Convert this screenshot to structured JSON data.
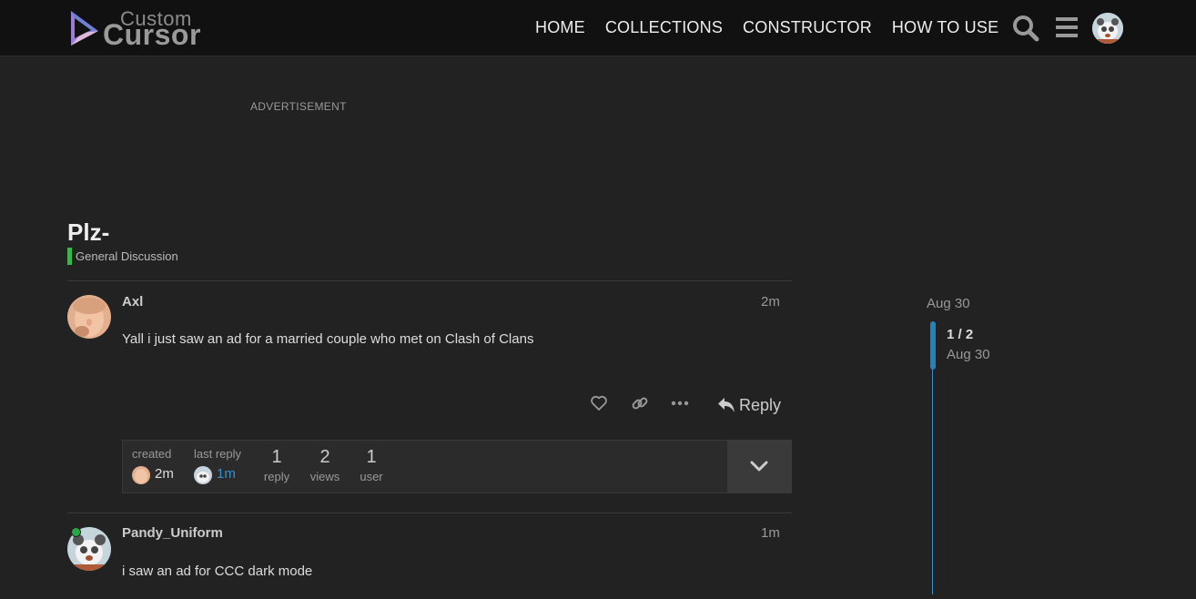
{
  "header": {
    "logo": {
      "line1": "Custom",
      "line2": "Cursor"
    },
    "nav": [
      "HOME",
      "COLLECTIONS",
      "CONSTRUCTOR",
      "HOW TO USE"
    ],
    "icons": [
      "search-icon",
      "hamburger-menu-icon",
      "user-avatar"
    ]
  },
  "ad": {
    "label": "ADVERTISEMENT"
  },
  "topic": {
    "title": "Plz-",
    "category": {
      "name": "General Discussion",
      "color": "#3ab54a"
    }
  },
  "posts": [
    {
      "username": "Axl",
      "age": "2m",
      "body": "Yall i just saw an ad for a married couple who met on Clash of Clans",
      "actions": [
        "heart-icon",
        "link-icon",
        "more-icon"
      ],
      "reply_label": "Reply"
    },
    {
      "username": "Pandy_Uniform",
      "age": "1m",
      "body": "i saw an ad for CCC dark mode",
      "online": true
    }
  ],
  "topic_map": {
    "created_label": "created",
    "created_time": "2m",
    "last_reply_label": "last reply",
    "last_reply_time": "1m",
    "stats": [
      {
        "value": "1",
        "label": "reply"
      },
      {
        "value": "2",
        "label": "views"
      },
      {
        "value": "1",
        "label": "user"
      }
    ]
  },
  "timeline": {
    "top_date": "Aug 30",
    "progress": "1 / 2",
    "current_date": "Aug 30",
    "accent_color": "#3a8fc9"
  },
  "colors": {
    "background": "#222222",
    "header": "#111111",
    "link": "#3a8fc9"
  }
}
